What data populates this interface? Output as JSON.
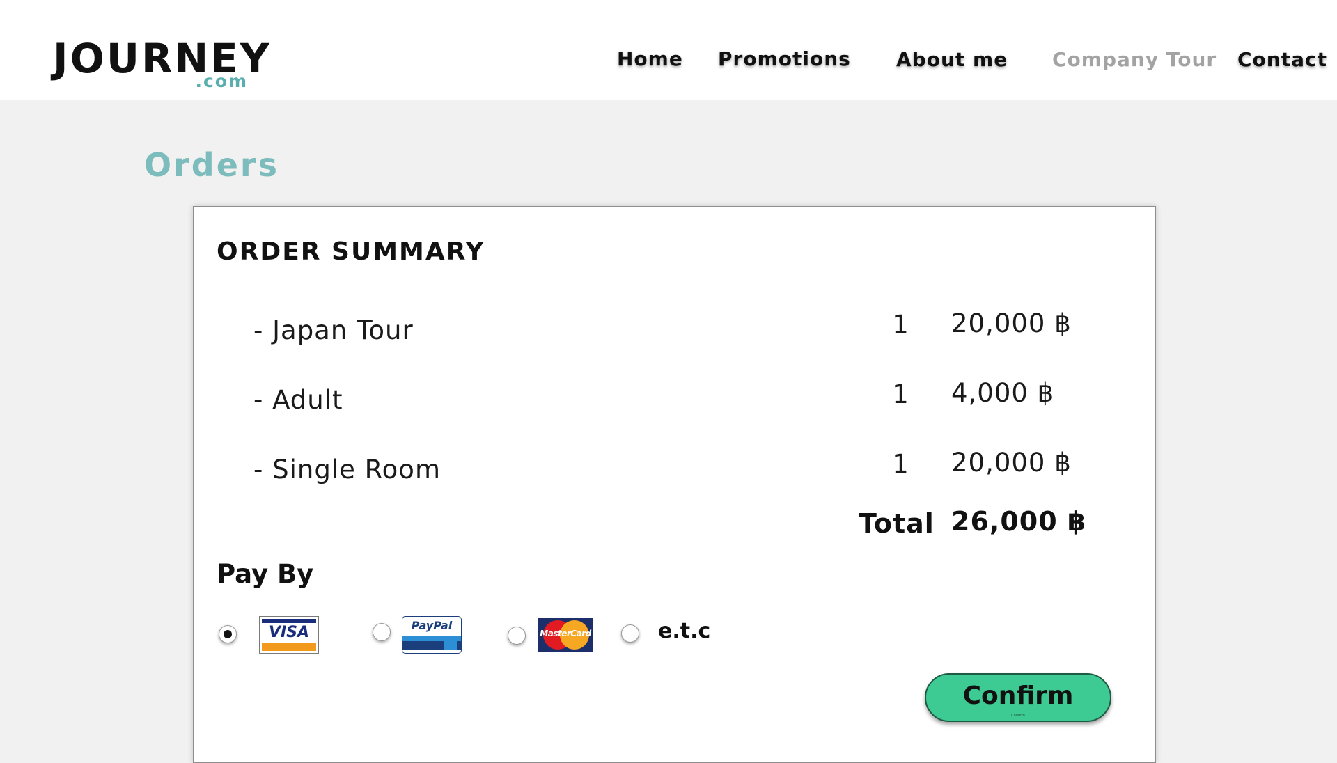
{
  "header": {
    "logo_main": "JOURNEY",
    "logo_sub": ".com",
    "nav": [
      {
        "label": "Home",
        "active": false
      },
      {
        "label": "Promotions",
        "active": false
      },
      {
        "label": "About me",
        "active": false
      },
      {
        "label": "Company Tour",
        "active": true
      },
      {
        "label": "Contact",
        "active": false
      }
    ]
  },
  "page_title": "Orders",
  "summary": {
    "title": "ORDER SUMMARY",
    "items": [
      {
        "name": "- Japan Tour",
        "qty": "1",
        "price": "20,000 ฿"
      },
      {
        "name": "- Adult",
        "qty": "1",
        "price": "4,000 ฿"
      },
      {
        "name": "- Single Room",
        "qty": "1",
        "price": "20,000 ฿"
      }
    ],
    "total_label": "Total",
    "total_value": "26,000 ฿"
  },
  "payment": {
    "label": "Pay By",
    "selected": "visa",
    "options": [
      {
        "id": "visa",
        "text": "VISA"
      },
      {
        "id": "paypal",
        "text": "PayPal"
      },
      {
        "id": "mastercard",
        "text": "MasterCard"
      },
      {
        "id": "etc",
        "text": "e.t.c"
      }
    ]
  },
  "confirm": {
    "label": "Confirm",
    "tiny_label": "Confirm"
  },
  "colors": {
    "accent_teal": "#7cbcbc",
    "confirm_green": "#3ecb93",
    "nav_active": "#a3a3a3"
  }
}
